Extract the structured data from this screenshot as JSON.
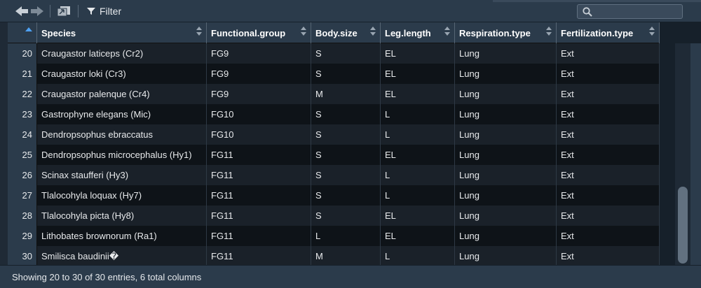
{
  "toolbar": {
    "filter_label": "Filter",
    "search_placeholder": ""
  },
  "table": {
    "columns": [
      "Species",
      "Functional.group",
      "Body.size",
      "Leg.length",
      "Respiration.type",
      "Fertilization.type"
    ],
    "rows": [
      {
        "index": "20",
        "cells": [
          "Craugastor laticeps (Cr2)",
          "FG9",
          "S",
          "EL",
          "Lung",
          "Ext"
        ]
      },
      {
        "index": "21",
        "cells": [
          "Craugastor loki (Cr3)",
          "FG9",
          "S",
          "EL",
          "Lung",
          "Ext"
        ]
      },
      {
        "index": "22",
        "cells": [
          "Craugastor palenque (Cr4)",
          "FG9",
          "M",
          "EL",
          "Lung",
          "Ext"
        ]
      },
      {
        "index": "23",
        "cells": [
          "Gastrophyne elegans (Mic)",
          "FG10",
          "S",
          "L",
          "Lung",
          "Ext"
        ]
      },
      {
        "index": "24",
        "cells": [
          "Dendropsophus ebraccatus",
          "FG10",
          "S",
          "L",
          "Lung",
          "Ext"
        ]
      },
      {
        "index": "25",
        "cells": [
          "Dendropsophus microcephalus  (Hy1)",
          "FG11",
          "S",
          "EL",
          "Lung",
          "Ext"
        ]
      },
      {
        "index": "26",
        "cells": [
          "Scinax staufferi (Hy3)",
          "FG11",
          "S",
          "L",
          "Lung",
          "Ext"
        ]
      },
      {
        "index": "27",
        "cells": [
          "Tlalocohyla loquax (Hy7)",
          "FG11",
          "S",
          "L",
          "Lung",
          "Ext"
        ]
      },
      {
        "index": "28",
        "cells": [
          "Tlalocohyla picta (Hy8)",
          "FG11",
          "S",
          "EL",
          "Lung",
          "Ext"
        ]
      },
      {
        "index": "29",
        "cells": [
          "Lithobates brownorum (Ra1)",
          "FG11",
          "L",
          "EL",
          "Lung",
          "Ext"
        ]
      },
      {
        "index": "30",
        "cells": [
          "Smilisca baudinii�",
          "FG11",
          "M",
          "L",
          "Lung",
          "Ext"
        ]
      }
    ]
  },
  "footer": {
    "status_text": "Showing 20 to 30 of 30 entries, 6 total columns"
  },
  "colors": {
    "toolbar_bg": "#2b3b4b",
    "row_odd": "#1a2129",
    "row_even": "#0e1318",
    "sort_accent": "#4ea1f3"
  }
}
